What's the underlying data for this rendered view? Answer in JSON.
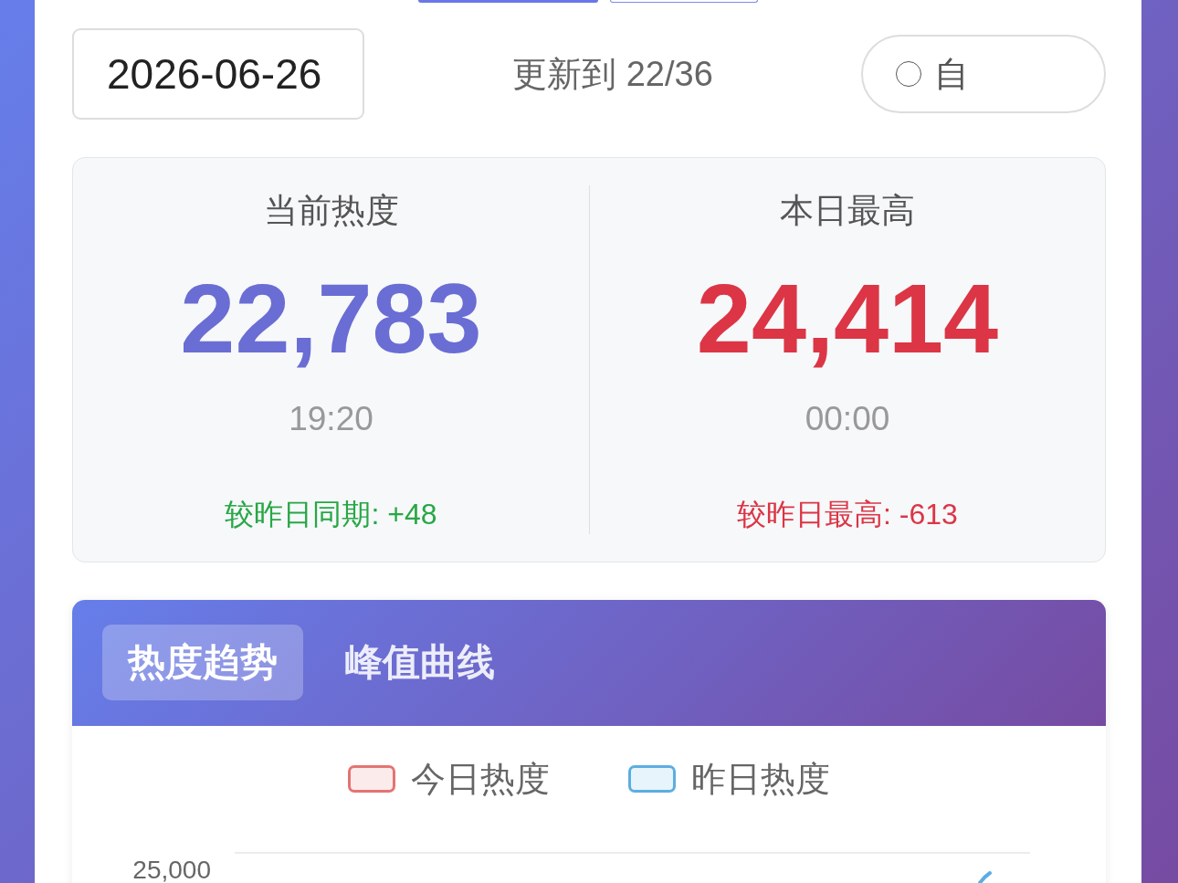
{
  "view_buttons": [
    {
      "selected": true
    },
    {
      "selected": false
    }
  ],
  "date_bar": {
    "date": "2026-06-26",
    "update_status": "更新到 22/36",
    "radio": {
      "label": "自",
      "checked": false
    }
  },
  "stats": [
    {
      "kind": "current",
      "label": "当前热度",
      "value": "22,783",
      "time": "19:20",
      "comparison": "较昨日同期: +48",
      "positive": true
    },
    {
      "kind": "peak",
      "label": "本日最高",
      "value": "24,414",
      "time": "00:00",
      "comparison": "较昨日最高: -613",
      "positive": false
    }
  ],
  "chart": {
    "tabs": [
      {
        "label": "热度趋势",
        "selected": true
      },
      {
        "label": "峰值曲线",
        "selected": false
      }
    ],
    "legend": [
      {
        "label": "今日热度",
        "color": "#e57373"
      },
      {
        "label": "昨日热度",
        "color": "#5dade2"
      }
    ],
    "y_axis_labels": [
      "25,000"
    ]
  }
}
